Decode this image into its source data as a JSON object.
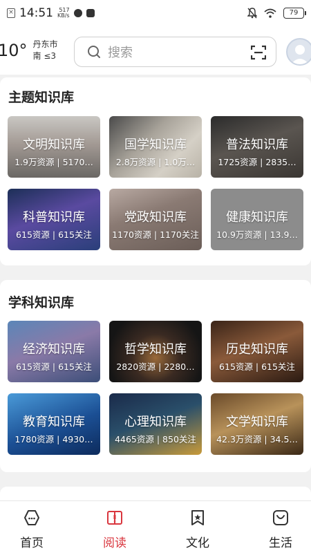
{
  "status_bar": {
    "time": "14:51",
    "net_speed_value": "517",
    "net_speed_unit": "KB/s",
    "battery": "79"
  },
  "header": {
    "temperature": "10°",
    "city": "丹东市",
    "wind": "南 ≤3",
    "search_placeholder": "搜索"
  },
  "sections": [
    {
      "title": "主题知识库",
      "cards": [
        {
          "name": "文明知识库",
          "stats": "1.9万资源 | 5170…"
        },
        {
          "name": "国学知识库",
          "stats": "2.8万资源 | 1.0万…"
        },
        {
          "name": "普法知识库",
          "stats": "1725资源 | 2835…"
        },
        {
          "name": "科普知识库",
          "stats": "615资源 | 615关注"
        },
        {
          "name": "党政知识库",
          "stats": "1170资源 | 1170关注"
        },
        {
          "name": "健康知识库",
          "stats": "10.9万资源 | 13.9…"
        }
      ]
    },
    {
      "title": "学科知识库",
      "cards": [
        {
          "name": "经济知识库",
          "stats": "615资源 | 615关注"
        },
        {
          "name": "哲学知识库",
          "stats": "2820资源 | 2280…"
        },
        {
          "name": "历史知识库",
          "stats": "615资源 | 615关注"
        },
        {
          "name": "教育知识库",
          "stats": "1780资源 | 4930…"
        },
        {
          "name": "心理知识库",
          "stats": "4465资源 | 850关注"
        },
        {
          "name": "文学知识库",
          "stats": "42.3万资源 | 34.5…"
        }
      ]
    }
  ],
  "tabs": [
    {
      "label": "首页",
      "icon": "home-icon"
    },
    {
      "label": "阅读",
      "icon": "book-icon",
      "active": true
    },
    {
      "label": "文化",
      "icon": "culture-icon"
    },
    {
      "label": "生活",
      "icon": "life-icon"
    }
  ],
  "colors": {
    "accent": "#d9363e",
    "background": "#f1f1f1"
  }
}
